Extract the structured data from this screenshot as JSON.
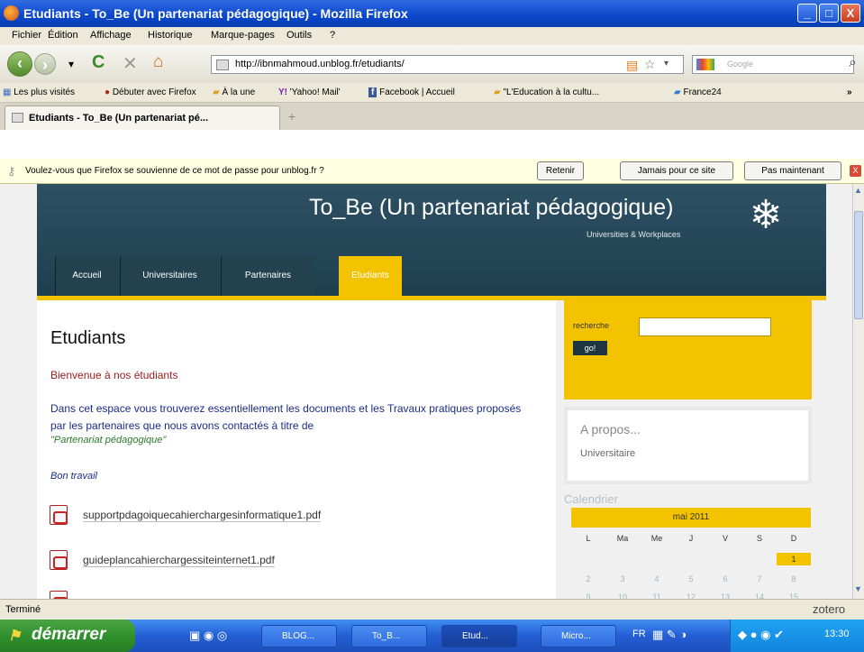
{
  "window": {
    "title": "Etudiants - To_Be (Un partenariat pédagogique) - Mozilla Firefox",
    "controls": [
      "_",
      "□",
      "X"
    ]
  },
  "menu": [
    "Fichier",
    "Édition",
    "Affichage",
    "Historique",
    "Marque-pages",
    "Outils",
    "?"
  ],
  "navigation": {
    "url": "http://ibnmahmoud.unblog.fr/etudiants/",
    "search_placeholder": "Google"
  },
  "bookmarks": [
    "Les plus visités",
    "Débuter avec Firefox",
    "À la une",
    "'Yahoo! Mail'",
    "Facebook | Accueil",
    "\"L'Education à la cultu...",
    "France24"
  ],
  "tab": {
    "label": "Etudiants - To_Be (Un partenariat pé...",
    "new_tab": "+"
  },
  "notification": {
    "text": "Voulez-vous que Firefox se souvienne de ce mot de passe pour unblog.fr ?",
    "buttons": [
      "Retenir",
      "Jamais pour ce site",
      "Pas maintenant"
    ],
    "close": "X"
  },
  "site": {
    "title": "To_Be (Un partenariat pédagogique)",
    "subtitle": "Universities & Workplaces",
    "nav": [
      "Accueil",
      "Universitaires",
      "Partenaires",
      "Etudiants"
    ]
  },
  "content": {
    "heading": "Etudiants",
    "welcome": "Bienvenue à nos étudiants",
    "paragraph_1": "Dans cet espace vous trouverez essentiellement les documents  et les Travaux pratiques proposés par les partenaires que nous avons contactés à titre de",
    "paragraph_2": "\"Partenariat pédagogique\"",
    "bon_travail": "Bon travail",
    "files": [
      "supportpdagoiquecahierchargesinformatique1.pdf",
      "guideplancahierchargessiteinternet1.pdf"
    ]
  },
  "sidebar": {
    "search_label": "recherche",
    "search_button": "go!",
    "about_title": "A propos...",
    "about_text": "Universitaire",
    "calendar_title": "Calendrier",
    "calendar_month": "mai 2011",
    "calendar_days": [
      "L",
      "Ma",
      "Me",
      "J",
      "V",
      "S",
      "D"
    ],
    "calendar_week1": [
      "",
      "",
      "",
      "",
      "",
      "",
      "1"
    ],
    "calendar_week2": [
      "2",
      "3",
      "4",
      "5",
      "6",
      "7",
      "8"
    ],
    "calendar_week3": [
      "9",
      "10",
      "11",
      "12",
      "13",
      "14",
      "15"
    ]
  },
  "status": {
    "text": "Terminé",
    "zotero": "zotero"
  },
  "taskbar": {
    "start": "démarrer",
    "items": [
      "BLOG...",
      "To_B...",
      "Etud...",
      "Micro..."
    ],
    "lang": "FR",
    "clock": "13:30"
  }
}
